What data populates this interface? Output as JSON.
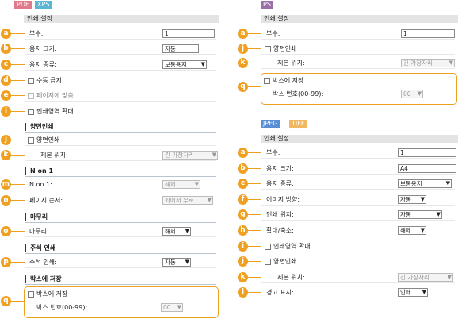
{
  "colors": {
    "tag_pdf": "#e07a8a",
    "tag_xps": "#5bb5d5",
    "tag_ps": "#9b6ea8",
    "tag_jpeg": "#5b8fd5",
    "tag_tiff": "#f0b860",
    "badge": "#f0a020"
  },
  "left": {
    "tags": [
      "PDF",
      "XPS"
    ],
    "header": "인쇄 설정",
    "rows": [
      {
        "badge": "a",
        "label": "부수:",
        "value": "1"
      },
      {
        "badge": "b",
        "label": "용지 크기:",
        "value": "자동"
      },
      {
        "badge": "c",
        "label": "용지 종류:",
        "value": "보통용지"
      },
      {
        "badge": "d",
        "label": "수동 급지"
      },
      {
        "badge": "e",
        "label": "페이지에 맞춤"
      },
      {
        "badge": "i",
        "label": "인쇄영역 확대"
      }
    ],
    "duplex": {
      "title": "양면인쇄",
      "rows": [
        {
          "badge": "j",
          "label": "양면인쇄"
        },
        {
          "badge": "k",
          "label": "제본 위치:",
          "value": "긴 가장자리"
        }
      ]
    },
    "nup": {
      "title": "N on 1",
      "rows": [
        {
          "badge": "m",
          "label": "N on 1:",
          "value": "해제"
        },
        {
          "badge": "n",
          "label": "페이지 순서:",
          "value": "좌에서 우로"
        }
      ]
    },
    "finish": {
      "title": "마무리",
      "rows": [
        {
          "badge": "o",
          "label": "마무리:",
          "value": "해제"
        }
      ]
    },
    "annot": {
      "title": "주석 인쇄",
      "rows": [
        {
          "badge": "p",
          "label": "주석 인쇄:",
          "value": "자동"
        }
      ]
    },
    "mailbox": {
      "title": "박스에 저장",
      "badge": "q",
      "check_label": "박스에 저장",
      "num_label": "박스 번호(00-99):",
      "num_value": "00"
    }
  },
  "right_ps": {
    "tag": "PS",
    "header": "인쇄 설정",
    "rows": [
      {
        "badge": "a",
        "label": "부수:",
        "value": "1"
      },
      {
        "badge": "j",
        "label": "양면인쇄"
      },
      {
        "badge": "k",
        "label": "제본 위치:",
        "value": "긴 가장자리"
      }
    ],
    "mailbox": {
      "badge": "q",
      "check_label": "박스에 저장",
      "num_label": "박스 번호(00-99):",
      "num_value": "00"
    }
  },
  "right_img": {
    "tags": [
      "JPEG",
      "TIFF"
    ],
    "header": "인쇄 설정",
    "rows": [
      {
        "badge": "a",
        "label": "부수:",
        "value": "1"
      },
      {
        "badge": "b",
        "label": "용지 크기:",
        "value": "A4"
      },
      {
        "badge": "c",
        "label": "용지 종류:",
        "value": "보통용지"
      },
      {
        "badge": "f",
        "label": "이미지 방향:",
        "value": "자동"
      },
      {
        "badge": "g",
        "label": "인쇄 위치:",
        "value": "자동"
      },
      {
        "badge": "h",
        "label": "확대/축소:",
        "value": "해제"
      },
      {
        "badge": "i",
        "label": "인쇄영역 확대"
      },
      {
        "badge": "j",
        "label": "양면인쇄"
      },
      {
        "badge": "k",
        "label": "제본 위치:",
        "value": "긴 가장자리"
      },
      {
        "badge": "l",
        "label": "경고 표시:",
        "value": "인쇄"
      }
    ]
  }
}
